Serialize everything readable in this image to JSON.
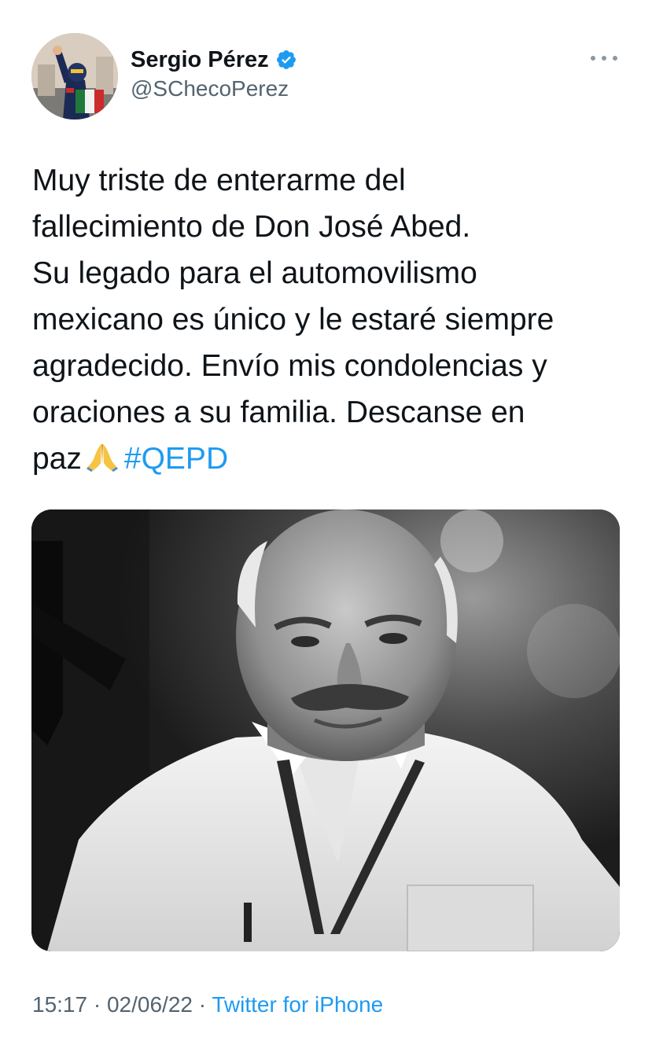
{
  "author": {
    "display_name": "Sergio Pérez",
    "handle": "@SChecoPerez",
    "verified_icon": "verified-badge-icon",
    "avatar": "profile-photo"
  },
  "tweet": {
    "lines": [
      "Muy triste de enterarme del",
      "fallecimiento de Don José Abed.",
      "Su legado para el automovilismo",
      "mexicano es único y le estaré siempre",
      "agradecido. Envío mis condolencias y",
      "oraciones a su familia. Descanse en"
    ],
    "last_line_text": "paz",
    "emoji": "folded-hands-icon",
    "hashtag": "#QEPD"
  },
  "media": {
    "description_icon": "black-and-white-portrait-photo",
    "has_mourning_ribbon": true
  },
  "meta": {
    "time": "15:17",
    "date": "02/06/22",
    "separator": "·",
    "source": "Twitter for iPhone"
  },
  "colors": {
    "link": "#1d9bf0",
    "secondary_text": "#536471",
    "primary_text": "#0f1419",
    "verified": "#1d9bf0"
  }
}
